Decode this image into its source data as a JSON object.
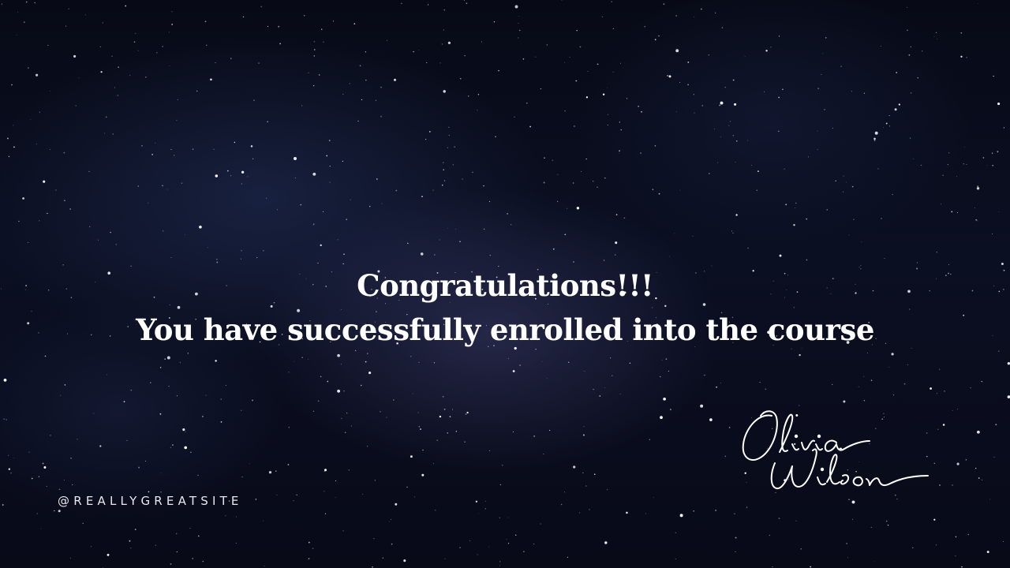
{
  "headline": {
    "line1": "Congratulations!!!",
    "line2": "You have successfully enrolled into the course"
  },
  "footer": {
    "handle": "@REALLYGREATSITE"
  },
  "signature": {
    "text": "Olivia Wilson"
  },
  "colors": {
    "background": "#070a16",
    "text": "#ffffff"
  }
}
